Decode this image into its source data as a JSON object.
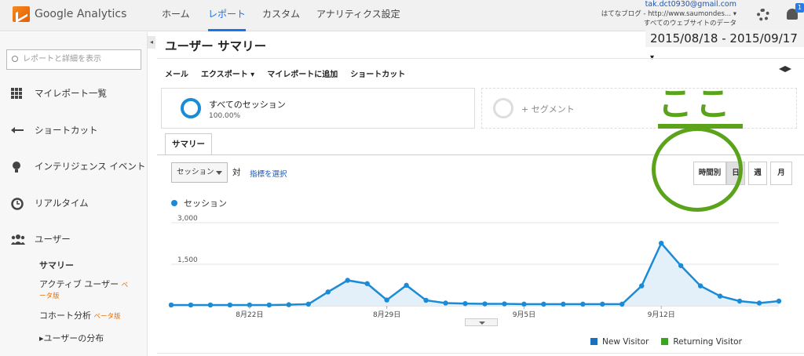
{
  "app": {
    "logo_text": "Google Analytics"
  },
  "topnav": {
    "items": [
      {
        "label": "ホーム"
      },
      {
        "label": "レポート"
      },
      {
        "label": "カスタム"
      },
      {
        "label": "アナリティクス設定"
      }
    ]
  },
  "account": {
    "email": "tak.dct0930@gmail.com",
    "property": "はてなブログ - http://www.saumondes...",
    "view": "すべてのウェブサイトのデータ",
    "badge": "1"
  },
  "sidebar": {
    "search_placeholder": "レポートと詳細を表示",
    "items": [
      {
        "label": "マイレポート一覧",
        "icon": "grid-icon"
      },
      {
        "label": "ショートカット",
        "icon": "shortcut-icon"
      },
      {
        "label": "インテリジェンス イベント",
        "icon": "lightbulb-icon"
      },
      {
        "label": "リアルタイム",
        "icon": "clock-icon"
      },
      {
        "label": "ユーザー",
        "icon": "users-icon"
      }
    ],
    "subitems": [
      {
        "label": "サマリー"
      },
      {
        "label": "アクティブ ユーザー",
        "beta": "ベータ版"
      },
      {
        "label": "コホート分析",
        "beta": "ベータ版"
      },
      {
        "label": "ユーザーの分布",
        "prefix": "▸"
      }
    ]
  },
  "page": {
    "title": "ユーザー サマリー",
    "date_range": "2015/08/18 - 2015/09/17"
  },
  "toolbar": {
    "mail": "メール",
    "export": "エクスポート ▾",
    "add": "マイレポートに追加",
    "shortcut": "ショートカット"
  },
  "segments": {
    "seg1_label": "すべてのセッション",
    "seg1_pct": "100.00%",
    "add_label": "+ セグメント"
  },
  "tabs": {
    "summary": "サマリー"
  },
  "controls": {
    "metric": "セッション",
    "vs": "対",
    "pick_metric": "指標を選択",
    "gran": [
      "時間別",
      "日",
      "週",
      "月"
    ]
  },
  "chart_data": {
    "type": "line",
    "legend": "セッション",
    "ylim": [
      0,
      3000
    ],
    "yticks": [
      "3,000",
      "1,500"
    ],
    "xticks": [
      "8月22日",
      "8月29日",
      "9月5日",
      "9月12日"
    ],
    "x": [
      "8/18",
      "8/19",
      "8/20",
      "8/21",
      "8/22",
      "8/23",
      "8/24",
      "8/25",
      "8/26",
      "8/27",
      "8/28",
      "8/29",
      "8/30",
      "8/31",
      "9/1",
      "9/2",
      "9/3",
      "9/4",
      "9/5",
      "9/6",
      "9/7",
      "9/8",
      "9/9",
      "9/10",
      "9/11",
      "9/12",
      "9/13",
      "9/14",
      "9/15",
      "9/16",
      "9/17"
    ],
    "series": [
      {
        "name": "セッション",
        "values": [
          30,
          30,
          30,
          30,
          30,
          30,
          40,
          60,
          500,
          920,
          800,
          210,
          740,
          200,
          100,
          80,
          70,
          70,
          60,
          60,
          60,
          60,
          60,
          60,
          720,
          2260,
          1450,
          720,
          350,
          170,
          100,
          170
        ]
      }
    ],
    "color": "#1a8bd6"
  },
  "bottom_legend": [
    {
      "label": "New Visitor",
      "color": "#1a6fbf"
    },
    {
      "label": "Returning Visitor",
      "color": "#3ca21f"
    }
  ],
  "annotation": {
    "text": "ここ"
  }
}
